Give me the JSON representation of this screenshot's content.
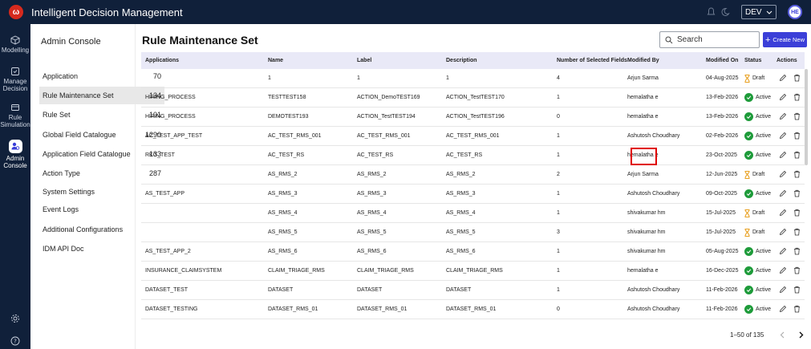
{
  "app": {
    "title": "Intelligent Decision Management",
    "logo_letter": "ω",
    "env": "DEV",
    "avatar": "HE"
  },
  "leftnav": [
    {
      "label": "Modelling",
      "icon": "cube-icon"
    },
    {
      "label": "Manage Decision",
      "icon": "decision-icon"
    },
    {
      "label": "Rule Simulation",
      "icon": "simulation-icon"
    },
    {
      "label": "Admin Console",
      "icon": "admin-icon",
      "active": true
    }
  ],
  "panel": {
    "title": "Admin Console",
    "items": [
      {
        "label": "Application",
        "count": "70"
      },
      {
        "label": "Rule Maintenance Set",
        "count": "134",
        "active": true
      },
      {
        "label": "Rule Set",
        "count": "101"
      },
      {
        "label": "Global Field Catalogue",
        "count": "1290"
      },
      {
        "label": "Application Field Catalogue",
        "count": "133"
      },
      {
        "label": "Action Type",
        "count": "287"
      },
      {
        "label": "System Settings",
        "count": ""
      },
      {
        "label": "Event Logs",
        "count": ""
      },
      {
        "label": "Additional Configurations",
        "count": ""
      },
      {
        "label": "IDM API Doc",
        "count": ""
      }
    ]
  },
  "main": {
    "title": "Rule Maintenance Set",
    "search_placeholder": "Search",
    "create_label": "Create New",
    "columns": [
      "Applications",
      "Name",
      "Label",
      "Description",
      "Number of Selected Fields",
      "Modified By",
      "Modified On",
      "Status",
      "Actions"
    ],
    "rows": [
      [
        "",
        "1",
        "1",
        "1",
        "4",
        "Arjun Sarma",
        "04-Aug-2025",
        "Draft"
      ],
      [
        "HIRING_PROCESS",
        "TESTTEST158",
        "ACTION_DemoTEST169",
        "ACTION_TestTEST170",
        "1",
        "hemalatha e",
        "13-Feb-2026",
        "Active"
      ],
      [
        "HIRING_PROCESS",
        "DEMOTEST193",
        "ACTION_TestTEST194",
        "ACTION_TestTEST196",
        "0",
        "hemalatha e",
        "13-Feb-2026",
        "Active"
      ],
      [
        "AC_TEST_APP_TEST",
        "AC_TEST_RMS_001",
        "AC_TEST_RMS_001",
        "AC_TEST_RMS_001",
        "1",
        "Ashutosh Choudhary",
        "02-Feb-2026",
        "Active"
      ],
      [
        "RKG_TEST",
        "AC_TEST_RS",
        "AC_TEST_RS",
        "AC_TEST_RS",
        "1",
        "hemalatha e",
        "23-Oct-2025",
        "Active"
      ],
      [
        "",
        "AS_RMS_2",
        "AS_RMS_2",
        "AS_RMS_2",
        "2",
        "Arjun Sarma",
        "12-Jun-2025",
        "Draft"
      ],
      [
        "AS_TEST_APP",
        "AS_RMS_3",
        "AS_RMS_3",
        "AS_RMS_3",
        "1",
        "Ashutosh Choudhary",
        "09-Oct-2025",
        "Active"
      ],
      [
        "",
        "AS_RMS_4",
        "AS_RMS_4",
        "AS_RMS_4",
        "1",
        "shivakumar hm",
        "15-Jul-2025",
        "Draft"
      ],
      [
        "",
        "AS_RMS_5",
        "AS_RMS_5",
        "AS_RMS_5",
        "3",
        "shivakumar hm",
        "15-Jul-2025",
        "Draft"
      ],
      [
        "AS_TEST_APP_2",
        "AS_RMS_6",
        "AS_RMS_6",
        "AS_RMS_6",
        "1",
        "shivakumar hm",
        "05-Aug-2025",
        "Active"
      ],
      [
        "INSURANCE_CLAIMSYSTEM",
        "CLAIM_TRIAGE_RMS",
        "CLAIM_TRIAGE_RMS",
        "CLAIM_TRIAGE_RMS",
        "1",
        "hemalatha e",
        "16-Dec-2025",
        "Active"
      ],
      [
        "DATASET_TEST",
        "DATASET",
        "DATASET",
        "DATASET",
        "1",
        "Ashutosh Choudhary",
        "11-Feb-2026",
        "Active"
      ],
      [
        "DATASET_TESTING",
        "DATASET_RMS_01",
        "DATASET_RMS_01",
        "DATASET_RMS_01",
        "0",
        "Ashutosh Choudhary",
        "11-Feb-2026",
        "Active"
      ]
    ],
    "pagination": "1–50 of 135"
  },
  "colors": {
    "nav_bg": "#10203a",
    "accent": "#3b3fd8",
    "active_green": "#1e9b3a",
    "draft_orange": "#e8a020",
    "header_bg": "#e9e9f7"
  }
}
